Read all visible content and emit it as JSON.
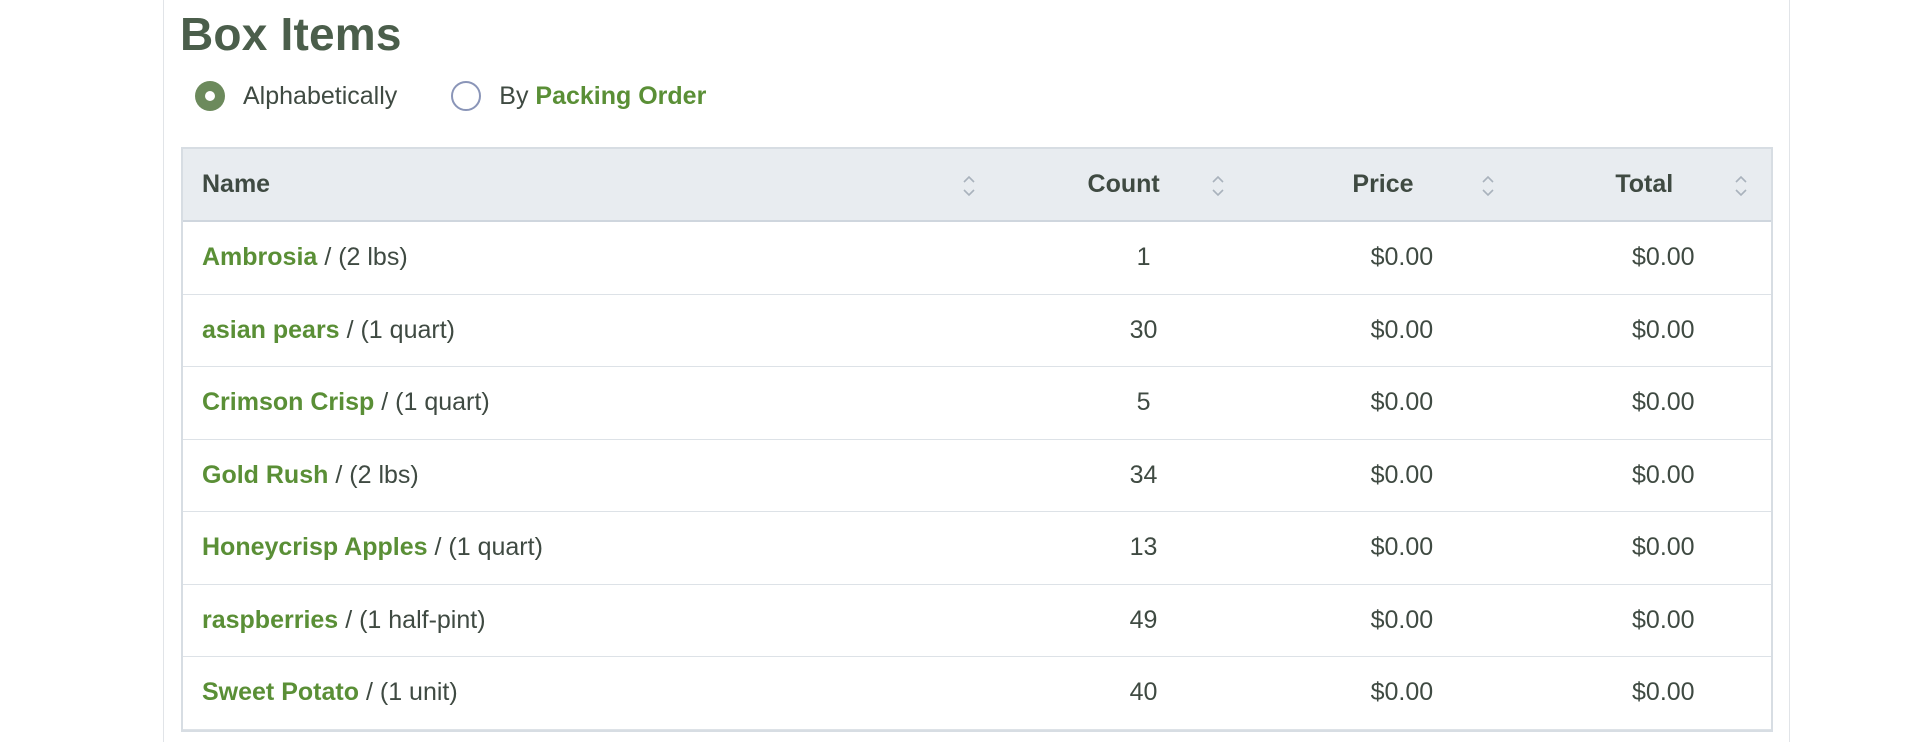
{
  "title": "Box Items",
  "sort": {
    "options": [
      {
        "label": "Alphabetically",
        "checked": true
      },
      {
        "prefix": "By",
        "link": "Packing Order",
        "checked": false
      }
    ]
  },
  "table": {
    "headers": [
      "Name",
      "Count",
      "Price",
      "Total"
    ],
    "rows": [
      {
        "name": "Ambrosia",
        "unit": "/ (2 lbs)",
        "count": "1",
        "price": "$0.00",
        "total": "$0.00"
      },
      {
        "name": "asian pears",
        "unit": "/ (1 quart)",
        "count": "30",
        "price": "$0.00",
        "total": "$0.00"
      },
      {
        "name": "Crimson Crisp",
        "unit": "/ (1 quart)",
        "count": "5",
        "price": "$0.00",
        "total": "$0.00"
      },
      {
        "name": "Gold Rush",
        "unit": "/ (2 lbs)",
        "count": "34",
        "price": "$0.00",
        "total": "$0.00"
      },
      {
        "name": "Honeycrisp Apples",
        "unit": "/ (1 quart)",
        "count": "13",
        "price": "$0.00",
        "total": "$0.00"
      },
      {
        "name": "raspberries",
        "unit": "/ (1 half-pint)",
        "count": "49",
        "price": "$0.00",
        "total": "$0.00"
      },
      {
        "name": "Sweet Potato",
        "unit": "/ (1 unit)",
        "count": "40",
        "price": "$0.00",
        "total": "$0.00"
      }
    ]
  },
  "colors": {
    "accent": "#5a8f36",
    "radio_checked": "#6c8a5c",
    "header_bg": "#e8ecf0",
    "title": "#4b5e4b"
  }
}
